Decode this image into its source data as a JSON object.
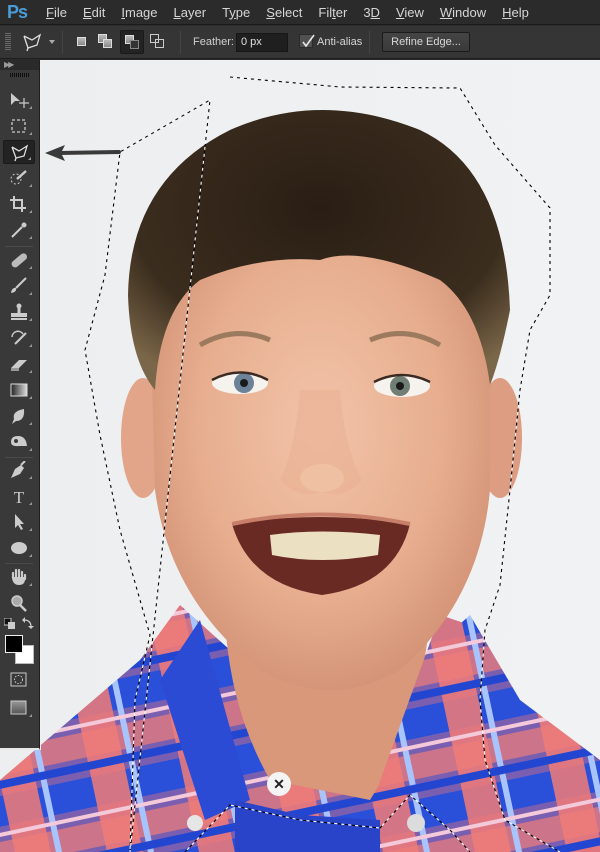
{
  "app": {
    "logo": "Ps"
  },
  "menubar": {
    "items": [
      {
        "label": "File",
        "mnemonic": "F"
      },
      {
        "label": "Edit",
        "mnemonic": "E"
      },
      {
        "label": "Image",
        "mnemonic": "I"
      },
      {
        "label": "Layer",
        "mnemonic": "L"
      },
      {
        "label": "Type",
        "mnemonic": "y"
      },
      {
        "label": "Select",
        "mnemonic": "S"
      },
      {
        "label": "Filter",
        "mnemonic": "t"
      },
      {
        "label": "3D",
        "mnemonic": "D"
      },
      {
        "label": "View",
        "mnemonic": "V"
      },
      {
        "label": "Window",
        "mnemonic": "W"
      },
      {
        "label": "Help",
        "mnemonic": "H"
      }
    ]
  },
  "options_bar": {
    "current_tool_icon": "polygonal-lasso-icon",
    "selection_modes": [
      {
        "name": "new-selection",
        "active": false
      },
      {
        "name": "add-to-selection",
        "active": false
      },
      {
        "name": "subtract-from-selection",
        "active": true
      },
      {
        "name": "intersect-with-selection",
        "active": false
      }
    ],
    "feather_label": "Feather:",
    "feather_value": "0 px",
    "anti_alias_label": "Anti-alias",
    "anti_alias_checked": true,
    "refine_edge_label": "Refine Edge..."
  },
  "toolbox": {
    "tools": [
      {
        "name": "move-tool",
        "icon": "move-icon"
      },
      {
        "name": "rectangular-marquee-tool",
        "icon": "marquee-icon"
      },
      {
        "name": "polygonal-lasso-tool",
        "icon": "polygonal-lasso-icon",
        "active": true
      },
      {
        "name": "quick-selection-tool",
        "icon": "quick-selection-icon"
      },
      {
        "name": "crop-tool",
        "icon": "crop-icon"
      },
      {
        "name": "eyedropper-tool",
        "icon": "eyedropper-icon"
      },
      {
        "name": "spot-healing-brush-tool",
        "icon": "bandage-icon"
      },
      {
        "name": "brush-tool",
        "icon": "brush-icon"
      },
      {
        "name": "clone-stamp-tool",
        "icon": "stamp-icon"
      },
      {
        "name": "history-brush-tool",
        "icon": "history-brush-icon"
      },
      {
        "name": "eraser-tool",
        "icon": "eraser-icon"
      },
      {
        "name": "gradient-tool",
        "icon": "gradient-icon"
      },
      {
        "name": "blur-tool",
        "icon": "blur-drop-icon"
      },
      {
        "name": "dodge-tool",
        "icon": "dodge-icon"
      },
      {
        "name": "pen-tool",
        "icon": "pen-icon"
      },
      {
        "name": "type-tool",
        "icon": "type-icon",
        "glyph": "T"
      },
      {
        "name": "path-selection-tool",
        "icon": "arrow-pointer-icon"
      },
      {
        "name": "ellipse-tool",
        "icon": "ellipse-icon"
      },
      {
        "name": "hand-tool",
        "icon": "hand-icon"
      },
      {
        "name": "zoom-tool",
        "icon": "magnifier-icon"
      }
    ],
    "foreground_color": "#000000",
    "background_color": "#ffffff",
    "quick_mask_icon": "quick-mask-icon",
    "screen_mode_icon": "screen-mode-icon"
  },
  "canvas": {
    "annotation": "arrow pointing to polygonal lasso tool",
    "background_color": "#eef0f1",
    "subject": "portrait of smiling boy in blue and coral plaid shirt with dashed selection outline"
  }
}
